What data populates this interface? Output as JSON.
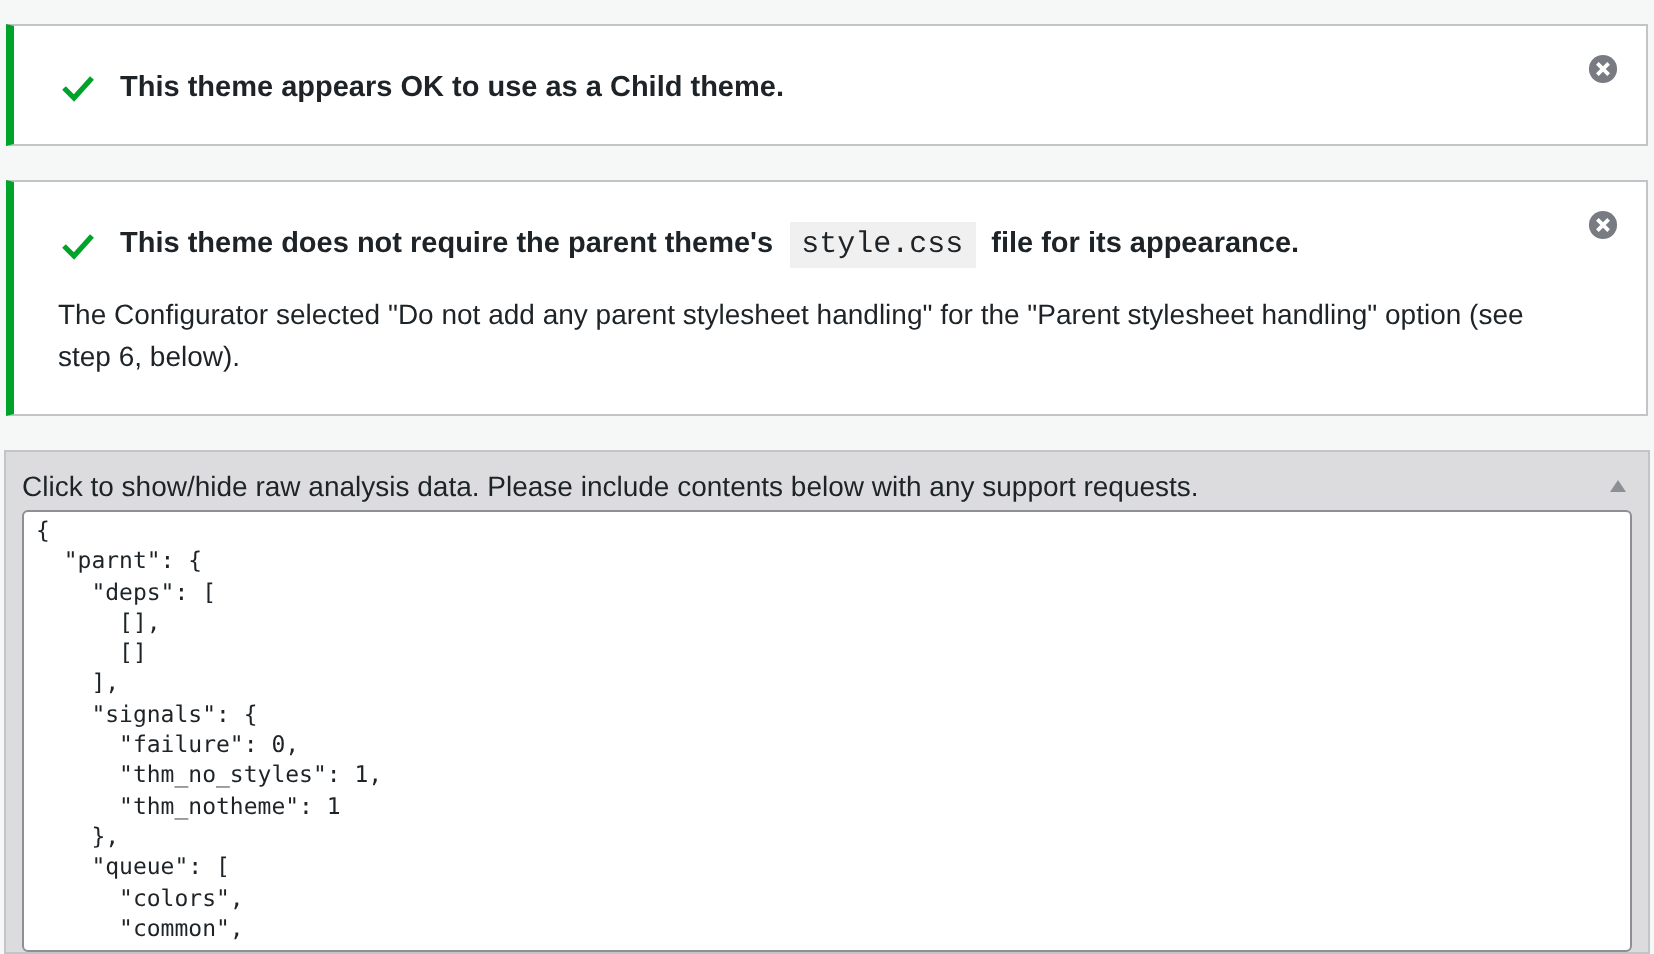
{
  "notices": [
    {
      "kind": "success",
      "title_parts": [
        "This theme appears OK to use as a Child theme."
      ],
      "dismissible": true
    },
    {
      "kind": "success",
      "title_parts": [
        "This theme does not require the parent theme's ",
        "style.css",
        " file for its appearance."
      ],
      "body": "The Configurator selected \"Do not add any parent stylesheet handling\" for the \"Parent stylesheet handling\" option (see step 6, below).",
      "dismissible": true
    }
  ],
  "raw_panel": {
    "header": "Click to show/hide raw analysis data. Please include contents below with any support requests.",
    "expanded": true,
    "lines": [
      "{",
      "  \"parnt\": {",
      "    \"deps\": [",
      "      [],",
      "      []",
      "    ],",
      "    \"signals\": {",
      "      \"failure\": 0,",
      "      \"thm_no_styles\": 1,",
      "      \"thm_notheme\": 1",
      "    },",
      "    \"queue\": [",
      "      \"colors\",",
      "      \"common\","
    ]
  }
}
